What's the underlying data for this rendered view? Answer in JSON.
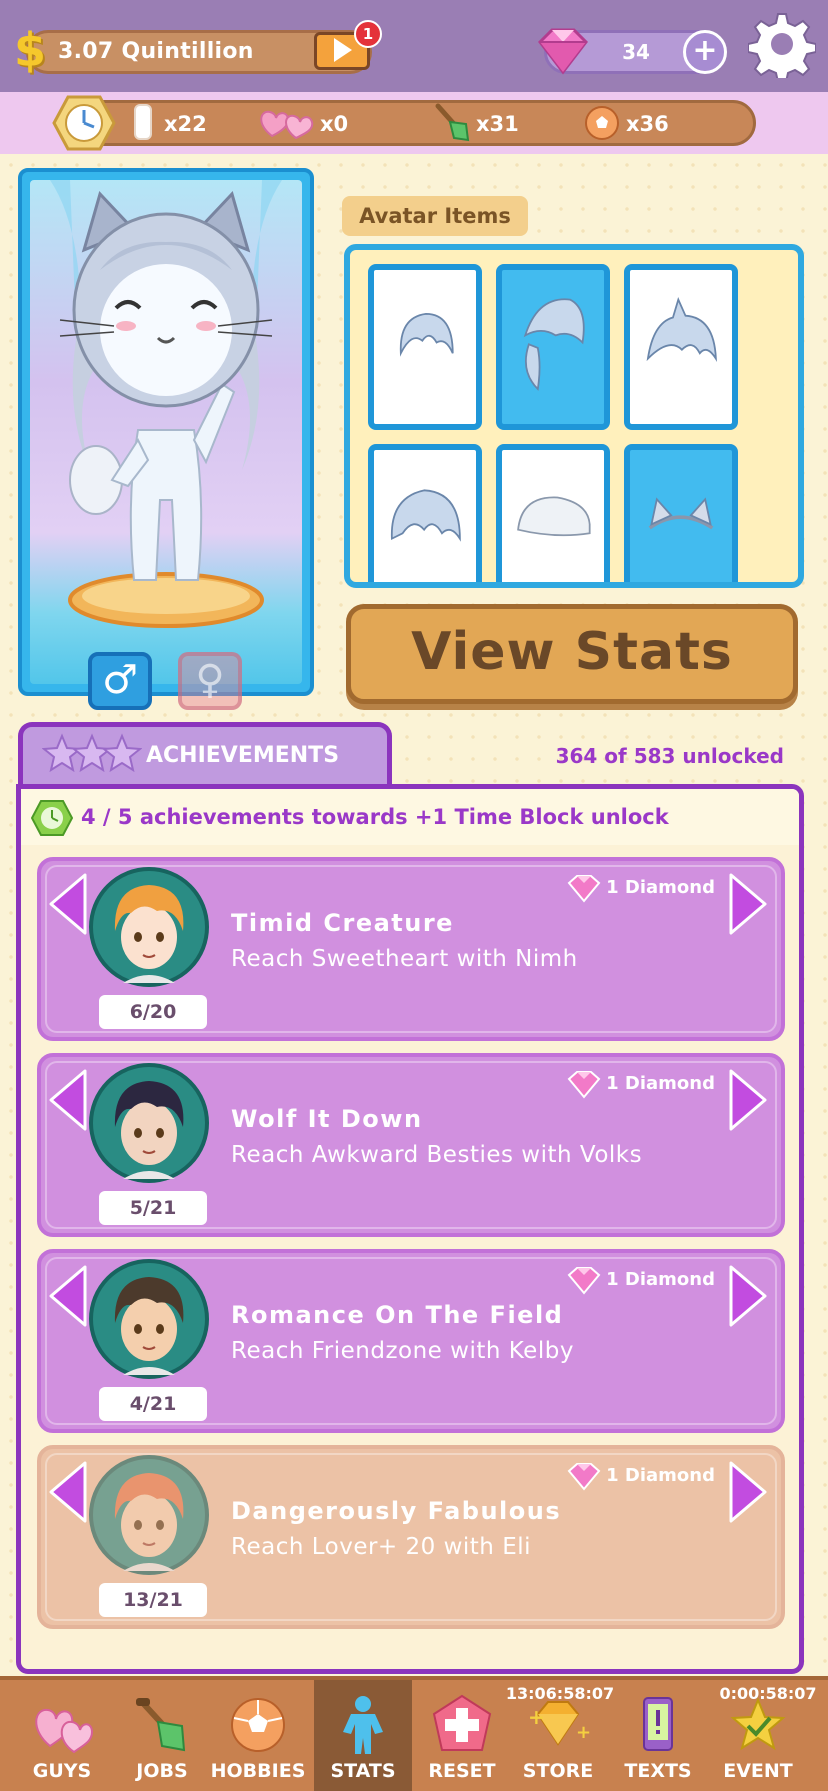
{
  "header": {
    "money": "3.07 Quintillion",
    "video_badge": "1",
    "diamonds": "34",
    "money_icon": "$",
    "plus_icon": "+"
  },
  "inventory": {
    "time_blocks": "x22",
    "hearts": "x0",
    "shovels": "x31",
    "balls": "x36"
  },
  "avatar": {
    "male_symbol": "♂",
    "female_symbol": "♀"
  },
  "avatar_items": {
    "label": "Avatar Items",
    "items": [
      {
        "icon": "hair-short-icon",
        "selected": false
      },
      {
        "icon": "hair-ponytail-icon",
        "selected": true
      },
      {
        "icon": "hair-spiky-icon",
        "selected": false
      },
      {
        "icon": "hair-messy-icon",
        "selected": false
      },
      {
        "icon": "cap-icon",
        "selected": false
      },
      {
        "icon": "cat-ears-icon",
        "selected": true
      }
    ]
  },
  "view_stats_label": "View Stats",
  "achievements": {
    "title": "ACHIEVEMENTS",
    "unlocked": "364 of 583 unlocked",
    "time_block_progress": "4 / 5 achievements towards +1 Time Block unlock",
    "items": [
      {
        "title": "Timid Creature",
        "desc": "Reach Sweetheart with Nimh",
        "progress": "6/20",
        "reward": "1 Diamond",
        "hair": "#f0a040",
        "skin": "#fbe1cf",
        "dim": false
      },
      {
        "title": "Wolf It Down",
        "desc": "Reach Awkward Besties with Volks",
        "progress": "5/21",
        "reward": "1 Diamond",
        "hair": "#2c2740",
        "skin": "#f2d4c0",
        "dim": false
      },
      {
        "title": "Romance On The Field",
        "desc": "Reach Friendzone with Kelby",
        "progress": "4/21",
        "reward": "1 Diamond",
        "hair": "#4c3a2c",
        "skin": "#f4cfad",
        "dim": false
      },
      {
        "title": "Dangerously Fabulous",
        "desc": "Reach Lover+ 20 with Eli",
        "progress": "13/21",
        "reward": "1 Diamond",
        "hair": "#e8764a",
        "skin": "#f6d2b2",
        "dim": true
      }
    ]
  },
  "nav": {
    "items": [
      {
        "label": "GUYS",
        "icon": "hearts-icon"
      },
      {
        "label": "JOBS",
        "icon": "shovel-icon"
      },
      {
        "label": "HOBBIES",
        "icon": "ball-icon"
      },
      {
        "label": "STATS",
        "icon": "person-icon"
      },
      {
        "label": "RESET",
        "icon": "reset-icon"
      },
      {
        "label": "STORE",
        "icon": "gem-icon"
      },
      {
        "label": "TEXTS",
        "icon": "phone-icon"
      },
      {
        "label": "EVENT",
        "icon": "star-icon"
      }
    ],
    "store_timer": "13:06:58:07",
    "event_timer": "0:00:58:07"
  },
  "colors": {
    "accent_purple": "#8b34bd",
    "card_purple": "#d190df",
    "topbar": "#9a7eb4",
    "nav_bg": "#c8814f"
  }
}
